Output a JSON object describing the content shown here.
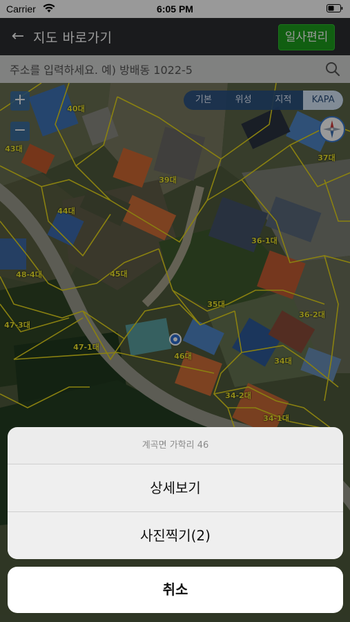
{
  "status_bar": {
    "carrier": "Carrier",
    "time": "6:05 PM"
  },
  "header": {
    "back_icon": "arrow-left-icon",
    "title": "지도 바로가기",
    "bookmark_label": "일사편리",
    "bookmark_color": "#1d9e1d"
  },
  "search": {
    "placeholder": "주소를 입력하세요. 예) 방배동 1022-5",
    "icon": "search-icon"
  },
  "map": {
    "zoom_in": "+",
    "zoom_out": "−",
    "tabs": [
      {
        "label": "기본"
      },
      {
        "label": "위성"
      },
      {
        "label": "지적"
      },
      {
        "label": "KAPA",
        "active": true
      }
    ],
    "parcel_labels": [
      "40대",
      "43대",
      "39대",
      "37대",
      "44대",
      "36-1대",
      "45대",
      "48-4대",
      "35대",
      "36-2대",
      "47-3대",
      "47-1대",
      "46대",
      "34대",
      "34-2대",
      "34-1대"
    ],
    "parcel_line_color": "#e6d71c"
  },
  "action_sheet": {
    "title": "계곡면 가학리 46",
    "actions": [
      {
        "label": "상세보기"
      },
      {
        "label": "사진찍기(2)"
      }
    ],
    "cancel_label": "취소"
  }
}
